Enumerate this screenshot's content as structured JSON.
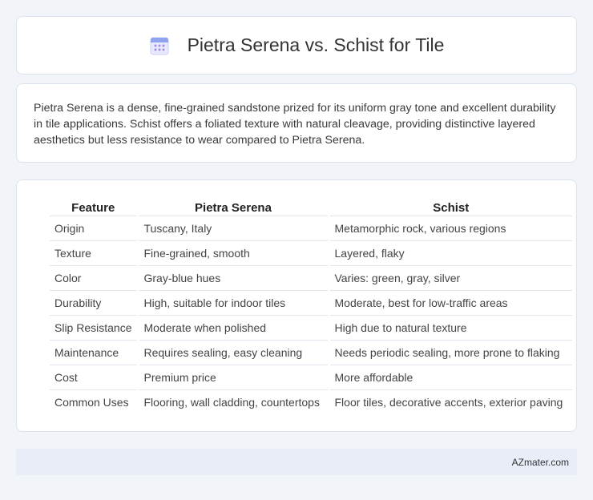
{
  "header": {
    "icon": "calendar-grid-icon",
    "title": "Pietra Serena vs. Schist for Tile"
  },
  "description": "Pietra Serena is a dense, fine-grained sandstone prized for its uniform gray tone and excellent durability in tile applications. Schist offers a foliated texture with natural cleavage, providing distinctive layered aesthetics but less resistance to wear compared to Pietra Serena.",
  "table": {
    "columns": [
      "Feature",
      "Pietra Serena",
      "Schist"
    ],
    "rows": [
      [
        "Origin",
        "Tuscany, Italy",
        "Metamorphic rock, various regions"
      ],
      [
        "Texture",
        "Fine-grained, smooth",
        "Layered, flaky"
      ],
      [
        "Color",
        "Gray-blue hues",
        "Varies: green, gray, silver"
      ],
      [
        "Durability",
        "High, suitable for indoor tiles",
        "Moderate, best for low-traffic areas"
      ],
      [
        "Slip Resistance",
        "Moderate when polished",
        "High due to natural texture"
      ],
      [
        "Maintenance",
        "Requires sealing, easy cleaning",
        "Needs periodic sealing, more prone to flaking"
      ],
      [
        "Cost",
        "Premium price",
        "More affordable"
      ],
      [
        "Common Uses",
        "Flooring, wall cladding, countertops",
        "Floor tiles, decorative accents, exterior paving"
      ]
    ]
  },
  "footer": {
    "source": "AZmater.com"
  },
  "colors": {
    "background": "#f1f4f9",
    "card": "#ffffff",
    "footer": "#e8edf7",
    "icon_accent": "#7b86e6"
  }
}
